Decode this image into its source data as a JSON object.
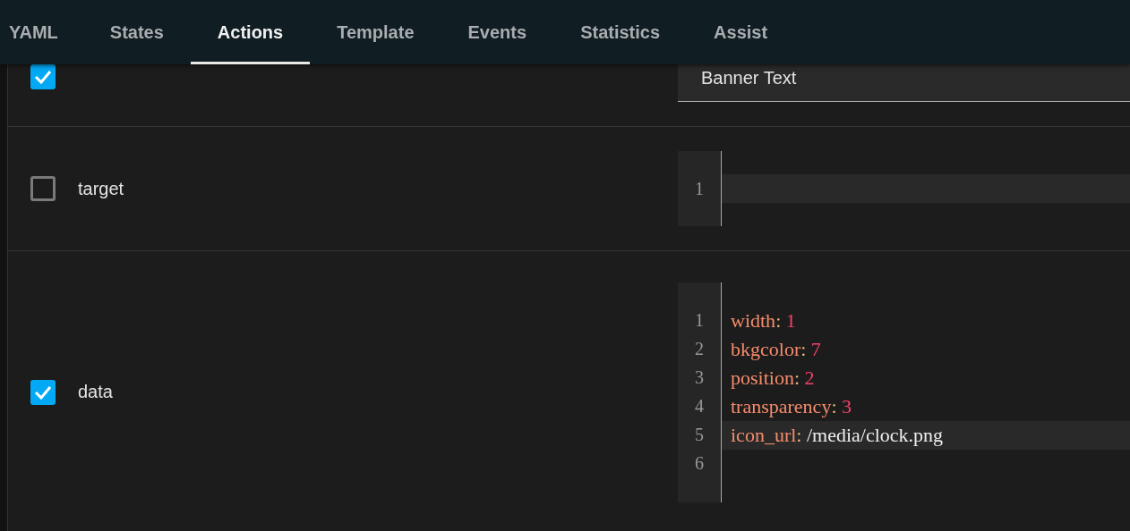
{
  "tabs": [
    {
      "label": "YAML",
      "selected": false
    },
    {
      "label": "States",
      "selected": false
    },
    {
      "label": "Actions",
      "selected": true
    },
    {
      "label": "Template",
      "selected": false
    },
    {
      "label": "Events",
      "selected": false
    },
    {
      "label": "Statistics",
      "selected": false
    },
    {
      "label": "Assist",
      "selected": false
    }
  ],
  "rows": [
    {
      "kind": "text",
      "checked": true,
      "value": "Banner Text"
    },
    {
      "kind": "code",
      "checked": false,
      "label": "target",
      "lines": [
        {
          "number": "1",
          "active": true
        }
      ]
    },
    {
      "kind": "code",
      "checked": true,
      "label": "data",
      "lines": [
        {
          "number": "1",
          "active": false,
          "key": "width",
          "separator": ":",
          "value": "1",
          "kind": "number"
        },
        {
          "number": "2",
          "active": false,
          "key": "bkgcolor",
          "separator": ":",
          "value": "7",
          "kind": "number"
        },
        {
          "number": "3",
          "active": false,
          "key": "position",
          "separator": ":",
          "value": "2",
          "kind": "number"
        },
        {
          "number": "4",
          "active": false,
          "key": "transparency",
          "separator": ":",
          "value": "3",
          "kind": "number"
        },
        {
          "number": "5",
          "active": true,
          "key": "icon_url",
          "separator": ":",
          "value": "/media/clock.png",
          "kind": "string"
        },
        {
          "number": "6",
          "active": false
        }
      ]
    }
  ]
}
